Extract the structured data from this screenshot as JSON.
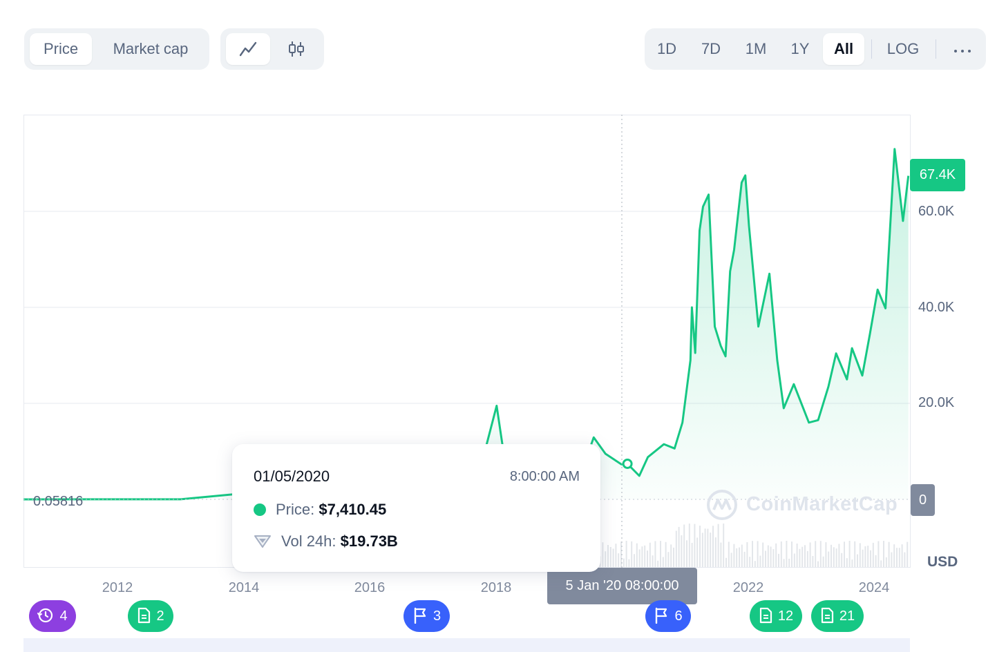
{
  "toolbar": {
    "view_tabs": [
      {
        "label": "Price",
        "active": true
      },
      {
        "label": "Market cap",
        "active": false
      }
    ],
    "chart_type": {
      "active": "line-chart-icon",
      "options": [
        "line-chart-icon",
        "candlestick-icon"
      ]
    },
    "ranges": [
      {
        "label": "1D",
        "active": false
      },
      {
        "label": "7D",
        "active": false
      },
      {
        "label": "1M",
        "active": false
      },
      {
        "label": "1Y",
        "active": false
      },
      {
        "label": "All",
        "active": true
      }
    ],
    "log_label": "LOG",
    "more_icon": "more-icon"
  },
  "tooltip": {
    "date": "01/05/2020",
    "time": "8:00:00 AM",
    "price_label": "Price:",
    "price_value": "$7,410.45",
    "vol_label": "Vol 24h:",
    "vol_value": "$19.73B"
  },
  "crosshair_label": "5 Jan '20 08:00:00",
  "current_price_tag": "67.4K",
  "zero_tag": "0",
  "min_label": "0.05816",
  "currency": "USD",
  "watermark": "CoinMarketCap",
  "events": [
    {
      "type": "history-icon",
      "count": "4",
      "color": "#8d3fe0"
    },
    {
      "type": "document-icon",
      "count": "2",
      "color": "#16c784"
    },
    {
      "type": "flag-icon",
      "count": "3",
      "color": "#3861fb"
    },
    {
      "type": "flag-icon",
      "count": "6",
      "color": "#3861fb"
    },
    {
      "type": "document-icon",
      "count": "12",
      "color": "#16c784"
    },
    {
      "type": "document-icon",
      "count": "21",
      "color": "#16c784"
    }
  ],
  "colors": {
    "line": "#16c784",
    "crosshair_tag": "#808a9d",
    "accent": "#16c784"
  },
  "chart_data": {
    "type": "area",
    "y_tick_labels": [
      "20.0K",
      "40.0K",
      "60.0K"
    ],
    "x_tick_labels": [
      "2012",
      "2014",
      "2016",
      "2018",
      "2022",
      "2024"
    ],
    "ylim": [
      0,
      70000
    ],
    "grid": true,
    "highlighted_point": {
      "date": "2020-01-05",
      "price": 7410.45,
      "volume_24h": "19.73B"
    },
    "series": [
      {
        "x": [
          "2010-07-17",
          "2012-01-01",
          "2013-01-01",
          "2013-11-30",
          "2014-06-01",
          "2015-01-15",
          "2016-01-01",
          "2017-01-01",
          "2017-09-01",
          "2017-12-17",
          "2018-02-06",
          "2018-06-01",
          "2018-11-01",
          "2018-12-15",
          "2019-04-01",
          "2019-06-26",
          "2019-09-01",
          "2019-12-01",
          "2020-01-05",
          "2020-03-13",
          "2020-05-01",
          "2020-08-01",
          "2020-10-01",
          "2020-11-15",
          "2020-12-31",
          "2021-01-08",
          "2021-01-27",
          "2021-02-21",
          "2021-03-13",
          "2021-04-14",
          "2021-05-19",
          "2021-06-22",
          "2021-07-20",
          "2021-08-15",
          "2021-09-07",
          "2021-10-20",
          "2021-11-10",
          "2021-12-01",
          "2022-01-24",
          "2022-03-28",
          "2022-05-12",
          "2022-06-18",
          "2022-08-15",
          "2022-11-09",
          "2023-01-01",
          "2023-03-01",
          "2023-04-14",
          "2023-06-15",
          "2023-07-14",
          "2023-09-11",
          "2023-10-25",
          "2023-12-08",
          "2024-01-22",
          "2024-03-14",
          "2024-05-01",
          "2024-06-01"
        ],
        "y": [
          0.05816,
          13,
          13.5,
          1150,
          620,
          210,
          430,
          1000,
          4500,
          19500,
          7000,
          7500,
          5500,
          3200,
          4100,
          12900,
          9500,
          7300,
          7410.45,
          4900,
          8800,
          11500,
          10600,
          16000,
          29000,
          40000,
          30500,
          56000,
          61000,
          63500,
          36000,
          32000,
          29800,
          47500,
          52000,
          66000,
          67500,
          57000,
          36000,
          47000,
          29000,
          19000,
          24000,
          16000,
          16500,
          23500,
          30400,
          25000,
          31500,
          25800,
          34500,
          43700,
          39800,
          73000,
          58000,
          67400
        ]
      }
    ]
  }
}
